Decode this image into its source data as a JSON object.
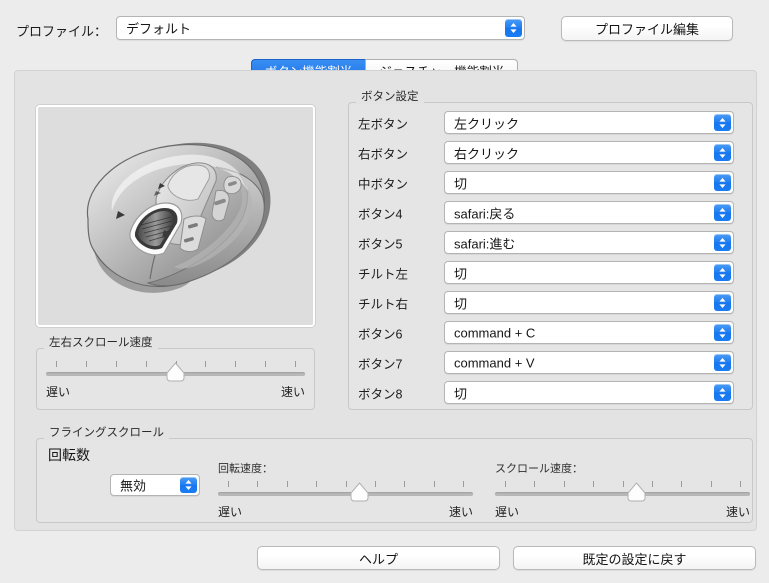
{
  "window": {
    "background_color": "#ececec",
    "accent_color": "#1a7cf2"
  },
  "profile": {
    "label": "プロファイル：",
    "selected": "デフォルト",
    "edit_button": "プロファイル編集"
  },
  "tabs": [
    {
      "label": "ボタン機能割当",
      "active": true
    },
    {
      "label": "ジェスチャー機能割当",
      "active": false
    }
  ],
  "mouse_preview": {
    "alt": "マウス図"
  },
  "button_settings": {
    "title": "ボタン設定",
    "rows": [
      {
        "label": "左ボタン",
        "value": "左クリック"
      },
      {
        "label": "右ボタン",
        "value": "右クリック"
      },
      {
        "label": "中ボタン",
        "value": "切"
      },
      {
        "label": "ボタン4",
        "value": "safari:戻る"
      },
      {
        "label": "ボタン5",
        "value": "safari:進む"
      },
      {
        "label": "チルト左",
        "value": "切"
      },
      {
        "label": "チルト右",
        "value": "切"
      },
      {
        "label": "ボタン6",
        "value": "command + C"
      },
      {
        "label": "ボタン7",
        "value": "command + V"
      },
      {
        "label": "ボタン8",
        "value": "切"
      }
    ]
  },
  "horizontal_scroll": {
    "title": "左右スクロール速度",
    "min_label": "遅い",
    "max_label": "速い",
    "ticks": 9,
    "value_percent": 50
  },
  "flying_scroll": {
    "title": "フライングスクロール",
    "rotation_count_label": "回転数",
    "rotation_count_value": "無効",
    "rotation_speed": {
      "caption": "回転速度：",
      "min_label": "遅い",
      "max_label": "速い",
      "ticks": 9,
      "value_percent": 56
    },
    "scroll_speed": {
      "caption": "スクロール速度：",
      "min_label": "遅い",
      "max_label": "速い",
      "ticks": 9,
      "value_percent": 56
    }
  },
  "footer": {
    "help_button": "ヘルプ",
    "restore_defaults_button": "既定の設定に戻す"
  }
}
